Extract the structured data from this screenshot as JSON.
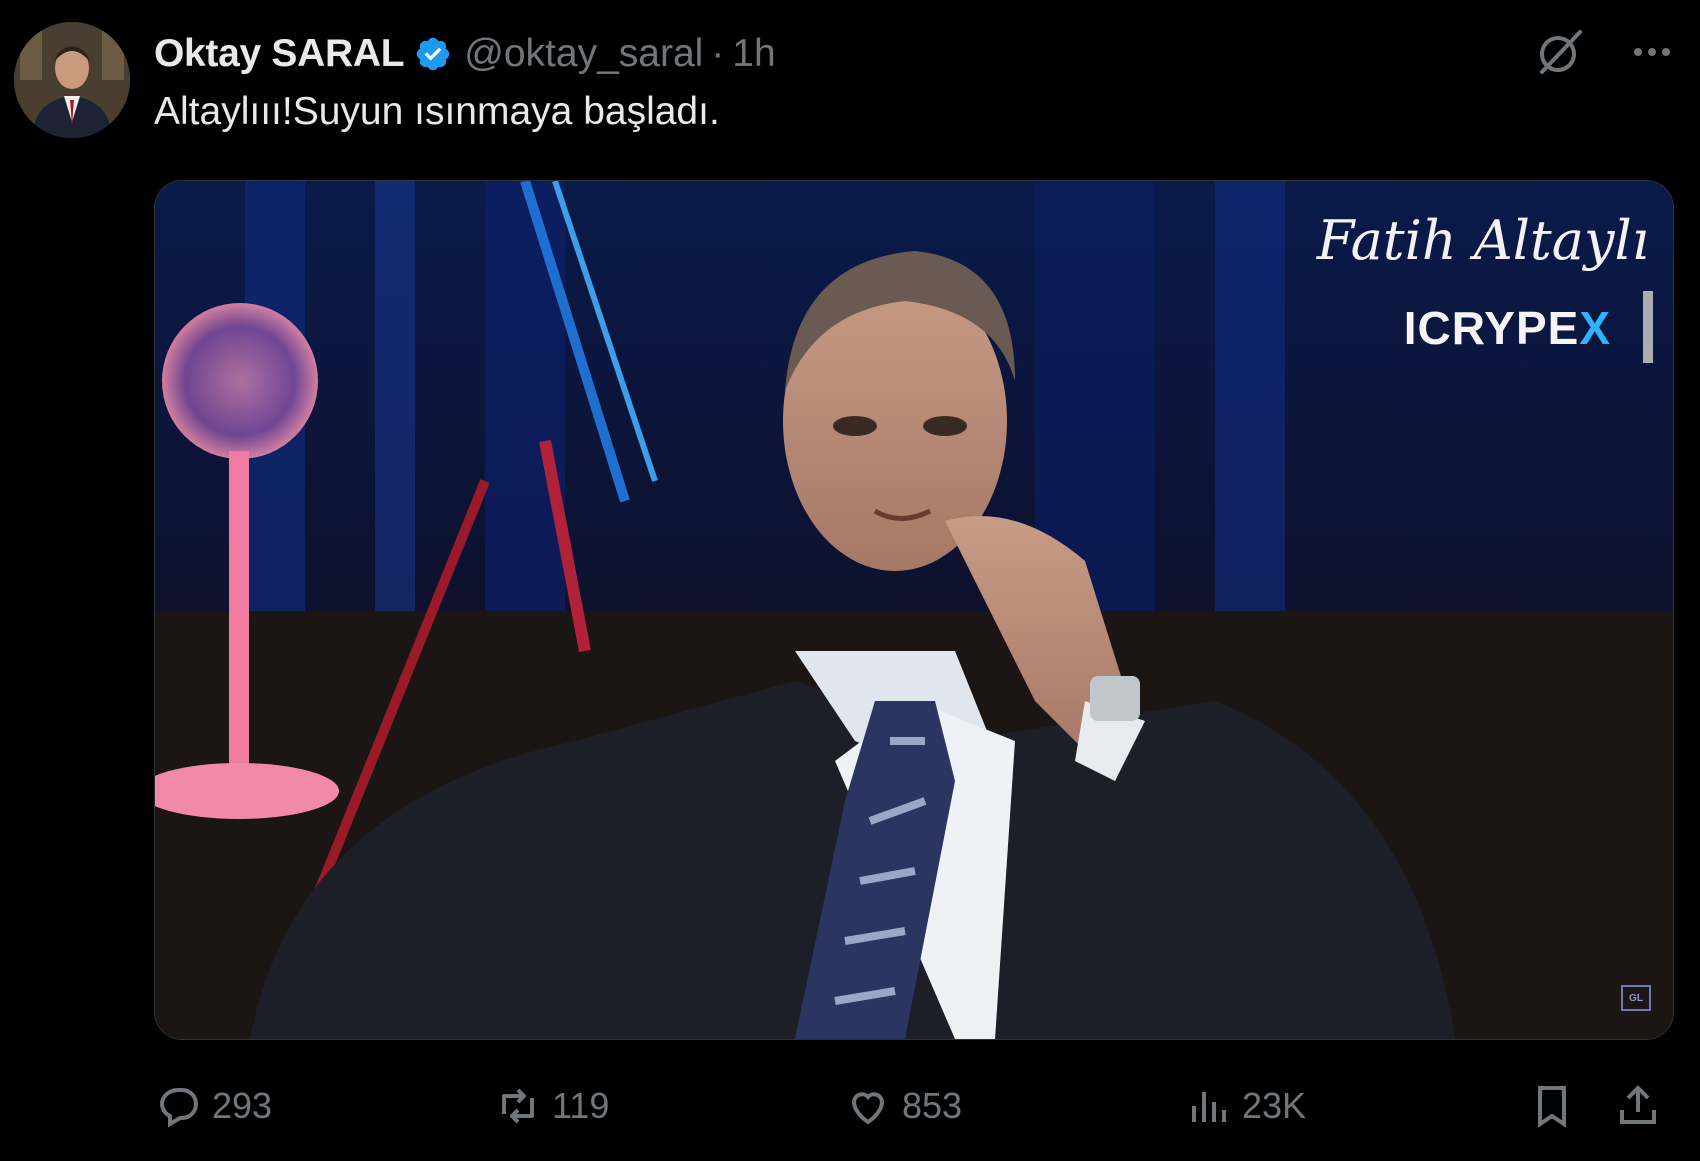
{
  "author": {
    "display_name": "Oktay SARAL",
    "handle": "@oktay_saral",
    "separator": "·",
    "time": "1h",
    "verified_icon": "verified-badge-icon",
    "verified_color": "#1d9bf0"
  },
  "tweet": {
    "text": "Altaylııı!Suyun ısınmaya başladı."
  },
  "media": {
    "overlay_name": "Fatih Altaylı",
    "overlay_brand_main": "ICRYPE",
    "overlay_brand_accent": "X",
    "corner_badge": "GL"
  },
  "top_icons": {
    "grok": "grok-icon",
    "more": "more-options-icon"
  },
  "actions": {
    "reply_count": "293",
    "retweet_count": "119",
    "like_count": "853",
    "views_count": "23K",
    "bookmark": "bookmark-icon",
    "share": "share-icon"
  },
  "colors": {
    "background": "#000000",
    "text_primary": "#e7e9ea",
    "text_secondary": "#71767b",
    "border": "#2f3336"
  }
}
